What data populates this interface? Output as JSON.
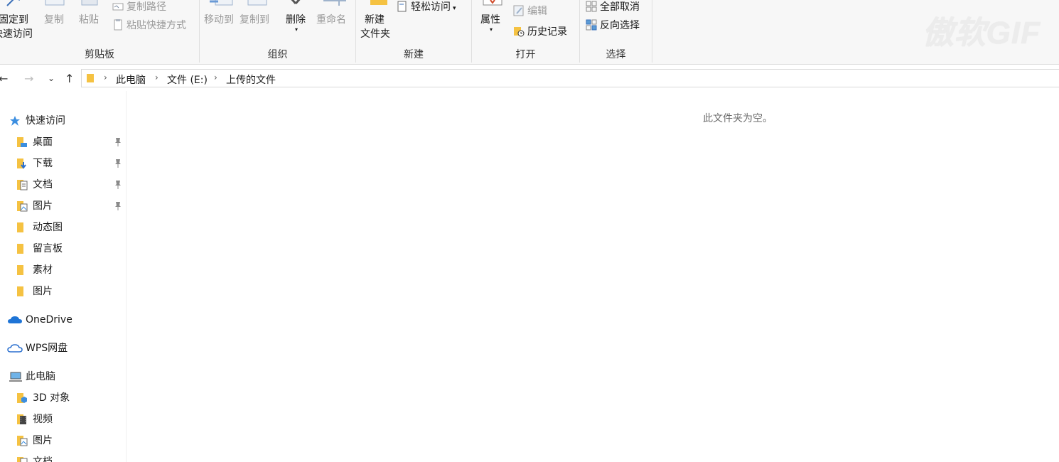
{
  "ribbon": {
    "clipboard": {
      "label": "剪贴板",
      "pin_line1": "固定到",
      "pin_line2": "快速访问",
      "copy": "复制",
      "paste": "粘贴",
      "copy_path": "复制路径",
      "paste_shortcut": "粘贴快捷方式"
    },
    "organize": {
      "label": "组织",
      "move_to": "移动到",
      "copy_to": "复制到",
      "delete": "删除",
      "rename": "重命名"
    },
    "new": {
      "label": "新建",
      "new_folder_line1": "新建",
      "new_folder_line2": "文件夹",
      "easy_access": "轻松访问"
    },
    "open": {
      "label": "打开",
      "properties": "属性",
      "edit": "编辑",
      "history": "历史记录"
    },
    "select": {
      "label": "选择",
      "select_none": "全部取消",
      "invert": "反向选择"
    }
  },
  "watermark": "傲软GIF",
  "address": {
    "crumbs": [
      "此电脑",
      "文件 (E:)",
      "上传的文件"
    ]
  },
  "sidebar": {
    "quick_access": "快速访问",
    "items": [
      {
        "label": "桌面",
        "pinned": true,
        "icon": "desktop-folder-icon"
      },
      {
        "label": "下载",
        "pinned": true,
        "icon": "download-folder-icon"
      },
      {
        "label": "文档",
        "pinned": true,
        "icon": "documents-folder-icon"
      },
      {
        "label": "图片",
        "pinned": true,
        "icon": "pictures-folder-icon"
      },
      {
        "label": "动态图",
        "pinned": false,
        "icon": "folder-icon"
      },
      {
        "label": "留言板",
        "pinned": false,
        "icon": "folder-icon"
      },
      {
        "label": "素材",
        "pinned": false,
        "icon": "folder-icon"
      },
      {
        "label": "图片",
        "pinned": false,
        "icon": "folder-icon"
      }
    ],
    "onedrive": "OneDrive",
    "wps": "WPS网盘",
    "this_pc": "此电脑",
    "pc_items": [
      {
        "label": "3D 对象",
        "icon": "3d-objects-icon"
      },
      {
        "label": "视频",
        "icon": "videos-folder-icon"
      },
      {
        "label": "图片",
        "icon": "pictures-folder-icon"
      },
      {
        "label": "文档",
        "icon": "documents-folder-icon"
      }
    ]
  },
  "main": {
    "empty_message": "此文件夹为空。"
  },
  "colors": {
    "folder": "#f5c242",
    "accent": "#1e74d6",
    "ribbon_bg": "#f7f7f7"
  }
}
